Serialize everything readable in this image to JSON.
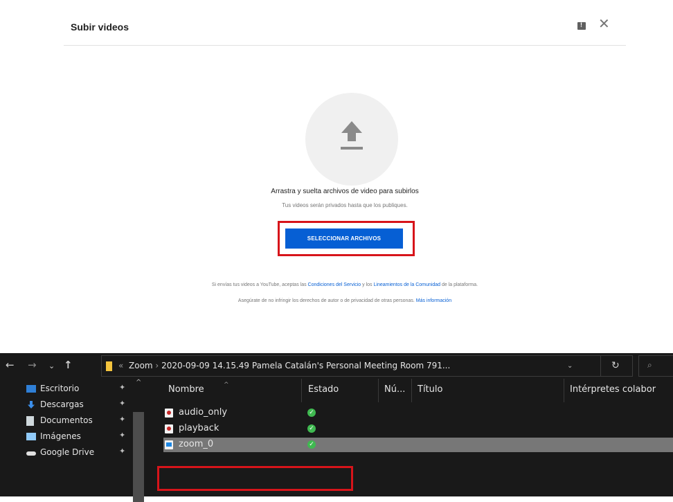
{
  "upload_dialog": {
    "title": "Subir videos",
    "close_glyph": "✕",
    "icons": [
      "feedback-icon",
      "close-icon",
      "upload-arrow-icon"
    ],
    "drag_text": "Arrastra y suelta archivos de video para subirlos",
    "privacy_text": "Tus videos serán privados hasta que los publiques.",
    "select_button": "SELECCIONAR ARCHIVOS",
    "terms": {
      "prefix": "Si envías tus videos a YouTube, aceptas las ",
      "link1": "Condiciones del Servicio",
      "middle": " y los ",
      "link2": "Lineamientos de la Comunidad",
      "suffix": " de la plataforma."
    },
    "copyright": {
      "text": "Asegúrate de no infringir los derechos de autor o de privacidad de otras personas. ",
      "link": "Más información"
    },
    "colors": {
      "button": "#065fd4",
      "highlight": "#d7141a"
    }
  },
  "explorer": {
    "nav": {
      "back": "←",
      "forward": "→",
      "recent": "⌄",
      "up": "↑"
    },
    "path_prefix": "«",
    "path_root": "Zoom",
    "path_separator": "›",
    "path_folder": "2020-09-09 14.15.49 Pamela Catalán's Personal Meeting Room 791...",
    "path_dropdown": "⌄",
    "refresh_glyph": "↻",
    "search_glyph": "⌕",
    "sidebar": [
      {
        "label": "Escritorio",
        "icon": "desktop-icon",
        "color": "#2f7fd6"
      },
      {
        "label": "Descargas",
        "icon": "downloads-icon",
        "color": "#3b8eea"
      },
      {
        "label": "Documentos",
        "icon": "documents-icon",
        "color": "#cfd8dc"
      },
      {
        "label": "Imágenes",
        "icon": "pictures-icon",
        "color": "#90caf9"
      },
      {
        "label": "Google Drive",
        "icon": "google-drive-icon",
        "color": "#e0e0e0"
      }
    ],
    "pin_glyph": "📌",
    "columns": [
      "Nombre",
      "Estado",
      "Nú...",
      "Título",
      "Intérpretes colabor"
    ],
    "files": [
      {
        "name": "audio_only",
        "icon": "audio-file-icon",
        "status": "synced"
      },
      {
        "name": "playback",
        "icon": "audio-file-icon",
        "status": "synced"
      },
      {
        "name": "zoom_0",
        "icon": "video-file-icon",
        "status": "synced",
        "selected": true
      }
    ],
    "status_glyph": "✓"
  }
}
